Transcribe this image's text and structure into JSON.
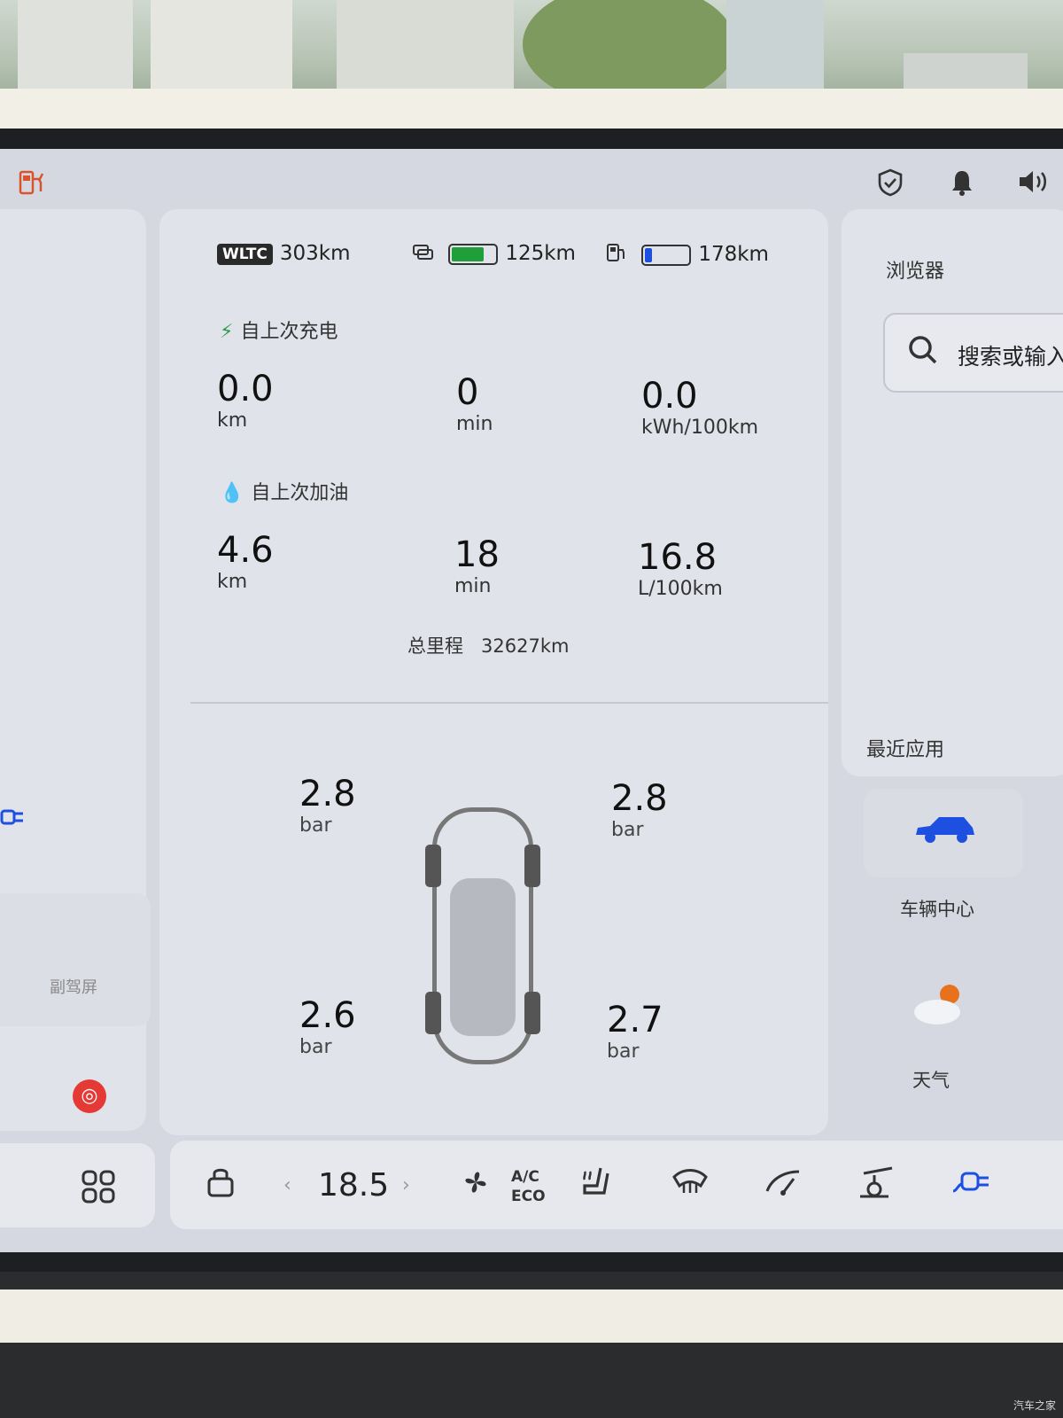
{
  "status_bar": {
    "fuel_station_icon": "fuel-pump-icon",
    "shield_icon": "shield-check-icon",
    "bell_icon": "bell-icon",
    "volume_icon": "volume-icon"
  },
  "range": {
    "wltc_badge": "WLTC",
    "wltc_value": "303km",
    "battery_value": "125km",
    "fuel_value": "178km",
    "battery_level": 0.75,
    "fuel_level": 0.15,
    "battery_color": "#1f9e3a",
    "fuel_color": "#1d4fe0"
  },
  "since_charge": {
    "title": "自上次充电",
    "distance": {
      "value": "0.0",
      "unit": "km"
    },
    "time": {
      "value": "0",
      "unit": "min"
    },
    "consumption": {
      "value": "0.0",
      "unit": "kWh/100km"
    }
  },
  "since_refuel": {
    "title": "自上次加油",
    "distance": {
      "value": "4.6",
      "unit": "km"
    },
    "time": {
      "value": "18",
      "unit": "min"
    },
    "consumption": {
      "value": "16.8",
      "unit": "L/100km"
    }
  },
  "odometer": {
    "label": "总里程",
    "value": "32627km"
  },
  "tires": {
    "front_left": {
      "value": "2.8",
      "unit": "bar"
    },
    "front_right": {
      "value": "2.8",
      "unit": "bar"
    },
    "rear_left": {
      "value": "2.6",
      "unit": "bar"
    },
    "rear_right": {
      "value": "2.7",
      "unit": "bar"
    }
  },
  "left_panel": {
    "sub_label": "副驾屏"
  },
  "browser": {
    "title": "浏览器",
    "search_placeholder": "搜索或输入"
  },
  "recent_apps": {
    "title": "最近应用",
    "items": [
      {
        "label": "车辆中心",
        "icon": "car-icon"
      },
      {
        "label": "天气",
        "icon": "weather-icon"
      }
    ]
  },
  "dock": {
    "temperature": "18.5",
    "ac_line1": "A/C",
    "ac_line2": "ECO"
  },
  "watermark": "汽车之家"
}
